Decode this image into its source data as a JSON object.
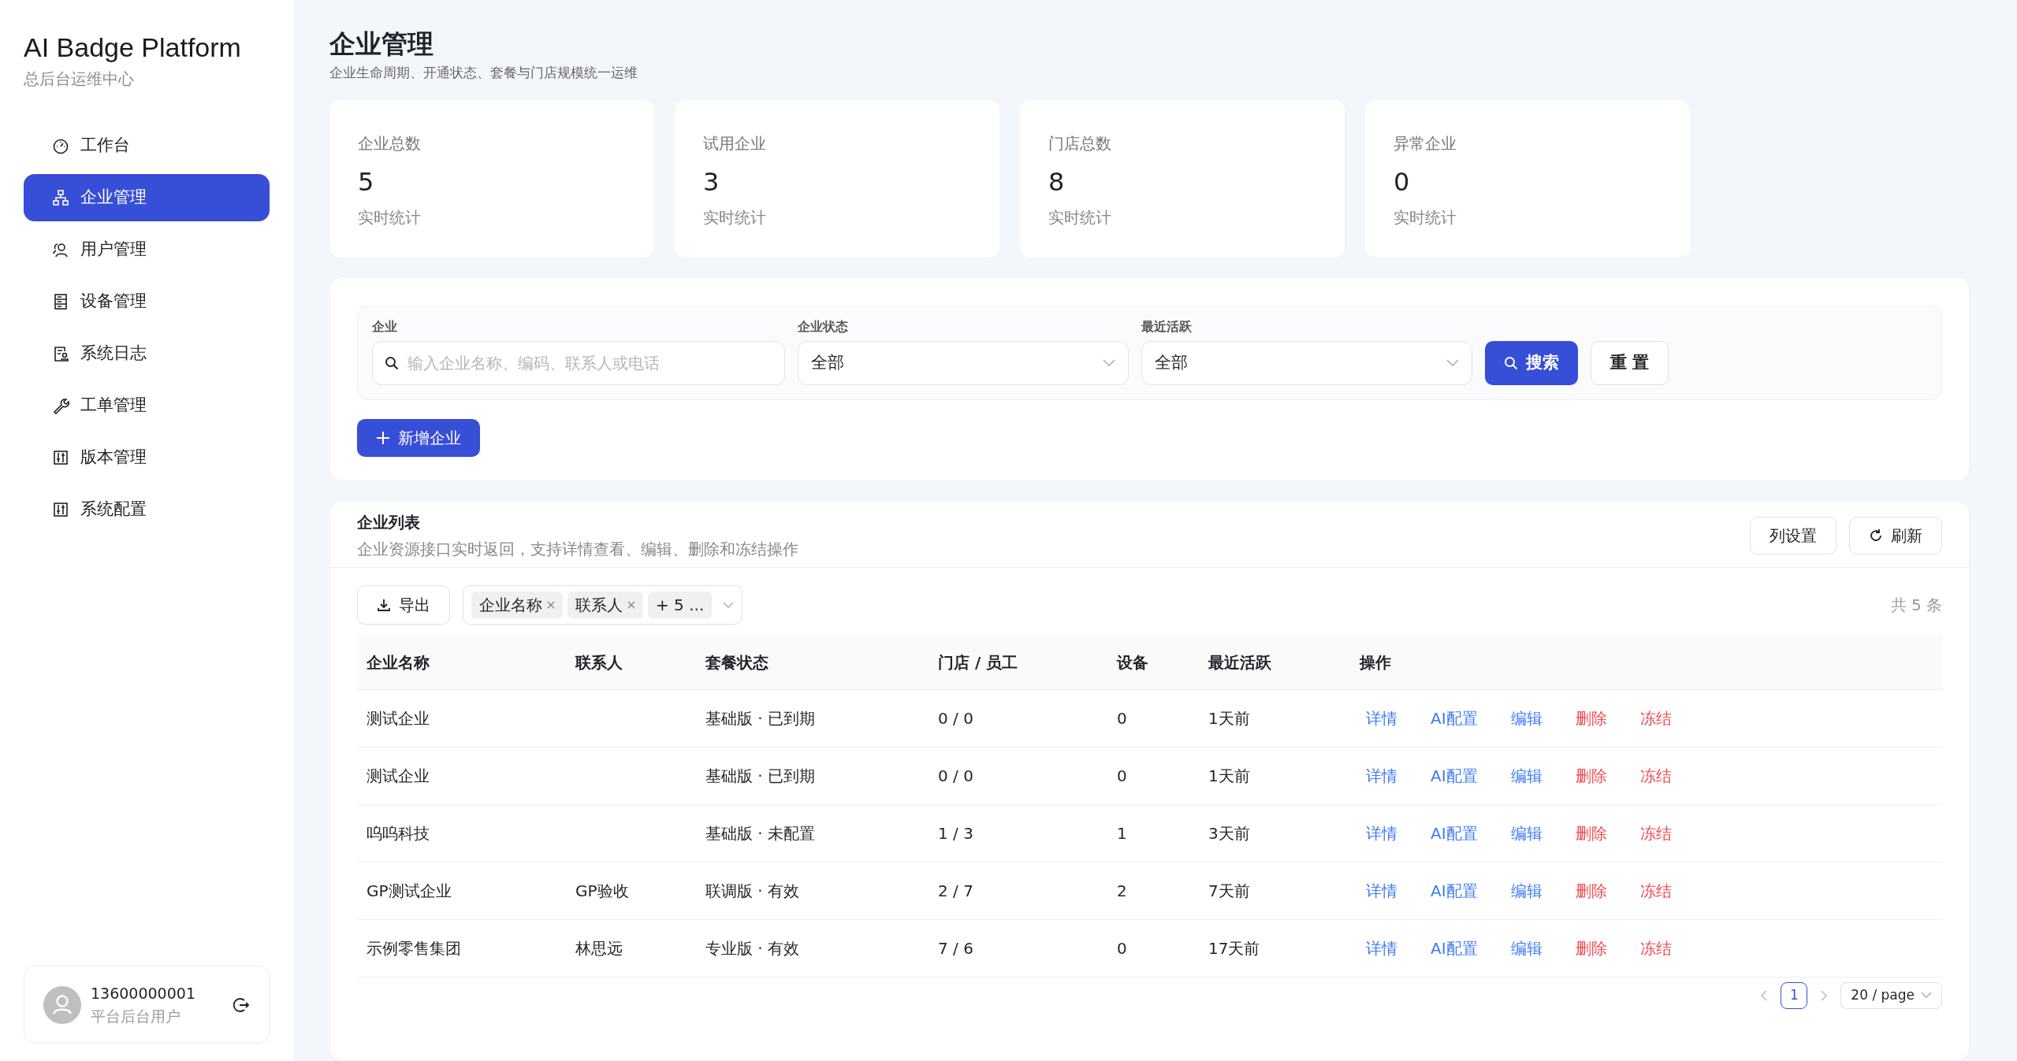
{
  "brand": {
    "title": "AI Badge Platform",
    "subtitle": "总后台运维中心"
  },
  "sidebar": {
    "items": [
      {
        "label": "工作台",
        "selected": false
      },
      {
        "label": "企业管理",
        "selected": true
      },
      {
        "label": "用户管理",
        "selected": false
      },
      {
        "label": "设备管理",
        "selected": false
      },
      {
        "label": "系统日志",
        "selected": false
      },
      {
        "label": "工单管理",
        "selected": false
      },
      {
        "label": "版本管理",
        "selected": false
      },
      {
        "label": "系统配置",
        "selected": false
      }
    ]
  },
  "user": {
    "name": "13600000001",
    "role": "平台后台用户"
  },
  "page": {
    "title": "企业管理",
    "subtitle": "企业生命周期、开通状态、套餐与门店规模统一运维"
  },
  "stats": [
    {
      "label": "企业总数",
      "value": "5",
      "note": "实时统计"
    },
    {
      "label": "试用企业",
      "value": "3",
      "note": "实时统计"
    },
    {
      "label": "门店总数",
      "value": "8",
      "note": "实时统计"
    },
    {
      "label": "异常企业",
      "value": "0",
      "note": "实时统计"
    }
  ],
  "filters": {
    "company": {
      "label": "企业",
      "placeholder": "输入企业名称、编码、联系人或电话"
    },
    "status": {
      "label": "企业状态",
      "value": "全部"
    },
    "activity": {
      "label": "最近活跃",
      "value": "全部"
    },
    "search_button": "搜索",
    "reset_button": "重 置",
    "add_button": "新增企业"
  },
  "list": {
    "title": "企业列表",
    "subtitle": "企业资源接口实时返回，支持详情查看、编辑、删除和冻结操作",
    "column_settings": "列设置",
    "refresh": "刷新",
    "export": "导出",
    "column_tags": [
      "企业名称",
      "联系人"
    ],
    "more_tags": "+ 5 ...",
    "total": "共 5 条"
  },
  "table": {
    "columns": [
      "企业名称",
      "联系人",
      "套餐状态",
      "门店 / 员工",
      "设备",
      "最近活跃",
      "操作"
    ],
    "rows": [
      {
        "name": "测试企业",
        "contact": "",
        "plan": "基础版 · 已到期",
        "stores": "0 / 0",
        "devices": "0",
        "active": "1天前",
        "actions": [
          {
            "label": "详情",
            "kind": "normal"
          },
          {
            "label": "AI配置",
            "kind": "normal"
          },
          {
            "label": "编辑",
            "kind": "normal"
          },
          {
            "label": "删除",
            "kind": "danger"
          },
          {
            "label": "冻结",
            "kind": "danger"
          }
        ]
      },
      {
        "name": "测试企业",
        "contact": "",
        "plan": "基础版 · 已到期",
        "stores": "0 / 0",
        "devices": "0",
        "active": "1天前",
        "actions": [
          {
            "label": "详情",
            "kind": "normal"
          },
          {
            "label": "AI配置",
            "kind": "normal"
          },
          {
            "label": "编辑",
            "kind": "normal"
          },
          {
            "label": "删除",
            "kind": "danger"
          },
          {
            "label": "冻结",
            "kind": "danger"
          }
        ]
      },
      {
        "name": "呜呜科技",
        "contact": "",
        "plan": "基础版 · 未配置",
        "stores": "1 / 3",
        "devices": "1",
        "active": "3天前",
        "actions": [
          {
            "label": "详情",
            "kind": "normal"
          },
          {
            "label": "AI配置",
            "kind": "normal"
          },
          {
            "label": "编辑",
            "kind": "normal"
          },
          {
            "label": "删除",
            "kind": "danger"
          },
          {
            "label": "冻结",
            "kind": "danger"
          }
        ]
      },
      {
        "name": "GP测试企业",
        "contact": "GP验收",
        "plan": "联调版 · 有效",
        "stores": "2 / 7",
        "devices": "2",
        "active": "7天前",
        "actions": [
          {
            "label": "详情",
            "kind": "normal"
          },
          {
            "label": "AI配置",
            "kind": "normal"
          },
          {
            "label": "编辑",
            "kind": "normal"
          },
          {
            "label": "删除",
            "kind": "danger"
          },
          {
            "label": "冻结",
            "kind": "danger"
          }
        ]
      },
      {
        "name": "示例零售集团",
        "contact": "林思远",
        "plan": "专业版 · 有效",
        "stores": "7 / 6",
        "devices": "0",
        "active": "17天前",
        "actions": [
          {
            "label": "详情",
            "kind": "normal"
          },
          {
            "label": "AI配置",
            "kind": "normal"
          },
          {
            "label": "编辑",
            "kind": "normal"
          },
          {
            "label": "删除",
            "kind": "danger"
          },
          {
            "label": "冻结",
            "kind": "danger"
          }
        ]
      }
    ]
  },
  "pagination": {
    "pages": [
      {
        "label": "1",
        "selected": true
      }
    ],
    "page_size": "20 / page"
  }
}
